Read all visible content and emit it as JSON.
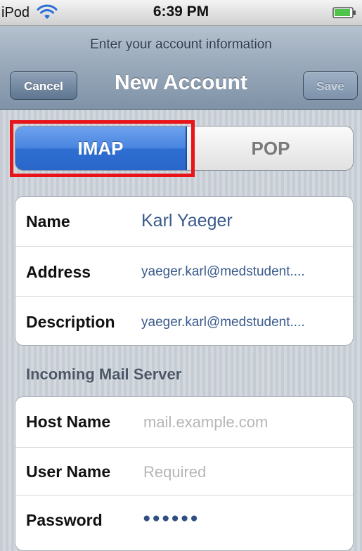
{
  "status_bar": {
    "carrier": "iPod",
    "time": "6:39 PM",
    "wifi_icon": "wifi-icon",
    "battery_icon": "battery-icon"
  },
  "nav": {
    "prompt": "Enter your account information",
    "title": "New Account",
    "cancel_label": "Cancel",
    "save_label": "Save"
  },
  "account_type": {
    "options": [
      "IMAP",
      "POP"
    ],
    "selected": "IMAP",
    "selected_color": "#3f7ee0",
    "highlight_color": "#e8141a"
  },
  "account_fields": [
    {
      "label": "Name",
      "value": "Karl Yaeger"
    },
    {
      "label": "Address",
      "value": "yaeger.karl@medstudent...."
    },
    {
      "label": "Description",
      "value": "yaeger.karl@medstudent...."
    }
  ],
  "incoming_server": {
    "header": "Incoming Mail Server",
    "fields": [
      {
        "label": "Host Name",
        "placeholder": "mail.example.com"
      },
      {
        "label": "User Name",
        "placeholder": "Required"
      },
      {
        "label": "Password",
        "value": "●●●●●●"
      }
    ]
  }
}
